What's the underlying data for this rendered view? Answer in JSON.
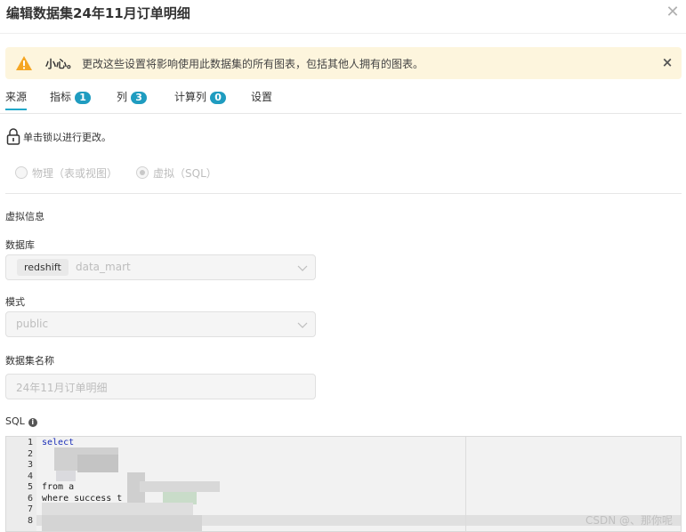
{
  "dialog": {
    "title": "编辑数据集24年11月订单明细",
    "close_glyph": "✕"
  },
  "alert": {
    "strong": "小心。",
    "message": "更改这些设置将影响使用此数据集的所有图表，包括其他人拥有的图表。",
    "close_glyph": "×",
    "color": "#fdf5dd",
    "icon_color": "#f5a623"
  },
  "tabs": [
    {
      "label": "来源",
      "badge": null,
      "active": true
    },
    {
      "label": "指标",
      "badge": "1"
    },
    {
      "label": "列",
      "badge": "3"
    },
    {
      "label": "计算列",
      "badge": "0"
    },
    {
      "label": "设置",
      "badge": null
    }
  ],
  "lock": {
    "text": "单击锁以进行更改。"
  },
  "source_type": {
    "options": [
      {
        "label": "物理（表或视图）",
        "checked": false
      },
      {
        "label": "虚拟（SQL）",
        "checked": true
      }
    ]
  },
  "virtual": {
    "section_title": "虚拟信息",
    "database_label": "数据库",
    "database_tag": "redshift",
    "database_value": "data_mart",
    "schema_label": "模式",
    "schema_value": "public",
    "dataset_name_label": "数据集名称",
    "dataset_name_value": "24年11月订单明细",
    "sql_label": "SQL"
  },
  "sql_editor": {
    "line_numbers": [
      "1",
      "2",
      "3",
      "4",
      "5",
      "6",
      "7",
      "8"
    ],
    "lines": [
      "select",
      "",
      "",
      "",
      "from a",
      "where success_t",
      "",
      ""
    ]
  },
  "watermark": "CSDN @、那你呢",
  "accent_color": "#20a7c9",
  "badge_color": "#1f9cc0"
}
